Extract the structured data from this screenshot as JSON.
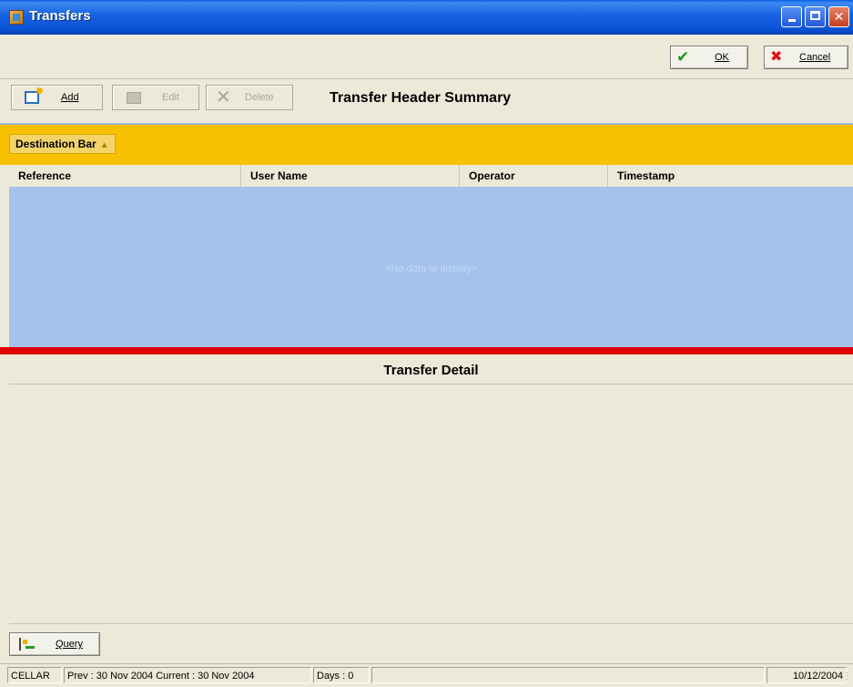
{
  "window": {
    "title": "Transfers",
    "controls": {
      "minimize": "minimize",
      "maximize": "maximize",
      "close": "✕"
    }
  },
  "actions": {
    "ok_label": "OK",
    "cancel_label": "Cancel"
  },
  "toolbar": {
    "add_label": "Add",
    "edit_label": "Edit",
    "delete_label": "Delete",
    "section_title": "Transfer Header Summary"
  },
  "grid": {
    "group_by": "Destination Bar",
    "columns": [
      "Reference",
      "User Name",
      "Operator",
      "Timestamp"
    ],
    "rows": [],
    "empty_text": "<No data to display>"
  },
  "detail": {
    "title": "Transfer Detail"
  },
  "query_label": "Query",
  "status": {
    "location": "CELLAR",
    "period": "Prev : 30 Nov 2004  Current : 30 Nov 2004",
    "days": "Days : 0",
    "extra": "",
    "date": "10/12/2004"
  },
  "colors": {
    "titlebar": "#0a52d6",
    "group_bar": "#f7c000",
    "grid_body": "#a3c3ec",
    "splitter": "#e00000"
  }
}
